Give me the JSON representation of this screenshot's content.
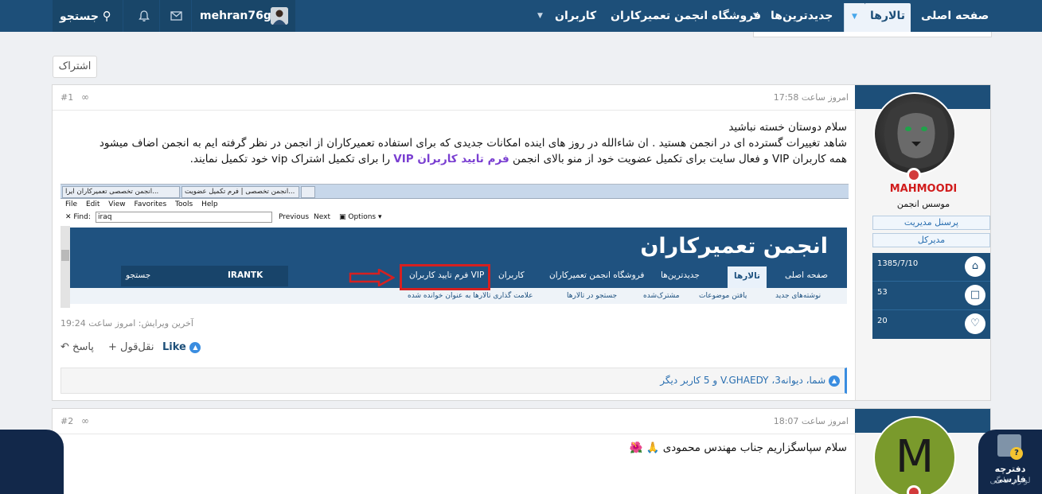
{
  "nav": {
    "home": "صفحه اصلی",
    "forums": "تالارها",
    "latest": "جدیدترین‌ها",
    "store": "فروشگاه انجمن تعمیرکاران",
    "members": "کاربران",
    "search": "جستجو",
    "username": "mehran76gh"
  },
  "share_button": "اشتراک",
  "post1": {
    "date": "امروز ساعت 17:58",
    "number": "#1",
    "line1": "سلام دوستان خسته نباشید",
    "line2": "شاهد تغییرات گسترده ای در انجمن هستید . ان شاءالله در روز های اینده امکانات جدیدی که برای استفاده تعمیرکاران از انجمن در نظر گرفته ایم به انجمن اضاف میشود",
    "line3_a": "همه کاربران VIP و فعال سایت برای تکمیل عضویت خود از منو بالای انجمن ",
    "line3_link": "فرم تایید کاربران VIP",
    "line3_b": " را برای تکمیل اشتراک vip خود تکمیل نمایند.",
    "last_edit": "آخرین ویرایش: امروز ساعت 19:24",
    "like": "Like",
    "quote": "نقل‌قول",
    "reply": "پاسخ",
    "reactions": "شما، دیوانه3، V.GHAEDY و 5 کاربر دیگر"
  },
  "user1": {
    "name": "MAHMOODI",
    "title": "موسس انجمن",
    "banner1": "پرسنل مدیریت",
    "banner2": "مدیرکل",
    "joined": "1385/7/10",
    "messages": "53",
    "reactions": "20"
  },
  "screenshot": {
    "tab1": "انجمن تخصصی تعمیرکاران ایرا...",
    "tab2": "انجمن تخصصی | فرم تکمیل عضویت...",
    "menu": [
      "File",
      "Edit",
      "View",
      "Favorites",
      "Tools",
      "Help"
    ],
    "find_label": "Find:",
    "find_value": "iraq",
    "previous": "Previous",
    "next": "Next",
    "options": "Options",
    "logo": "انجمن تعمیرکاران",
    "nav_home": "صفحه اصلی",
    "nav_forums": "تالارها",
    "nav_latest": "جدیدترین‌ها",
    "nav_store": "فروشگاه انجمن تعمیرکاران",
    "nav_members": "کاربران",
    "nav_vip": "فرم تایید کاربران VIP",
    "nav_search": "جستجو",
    "nav_user": "IRANTK",
    "sub1": "نوشته‌های جدید",
    "sub2": "یافتن موضوعات",
    "sub3": "مشترک‌شده",
    "sub4": "جستجو در تالارها",
    "sub5": "علامت گذاری تالارها به عنوان خوانده شده"
  },
  "post2": {
    "date": "امروز ساعت 18:07",
    "number": "#2",
    "text": "سلام سپاسگزاریم جناب مهندس محمودی 🙏 🌺",
    "avatar_letter": "M"
  },
  "corner": {
    "title": "دفترچه فارسی",
    "subtitle": "لوازم خانگی",
    "badge": "?"
  }
}
